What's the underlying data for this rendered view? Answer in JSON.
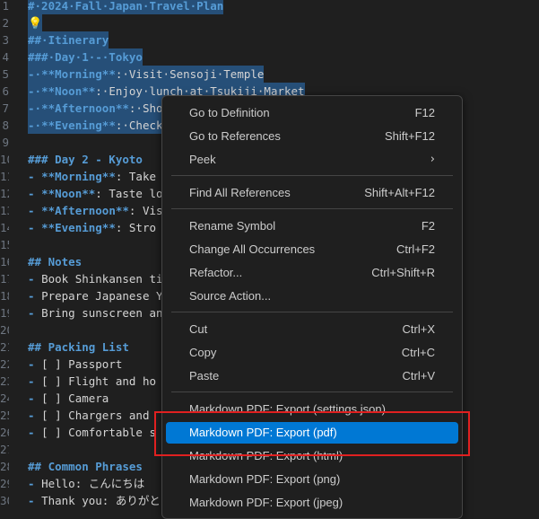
{
  "editor": {
    "lines": [
      {
        "num": "1",
        "segs": [
          {
            "t": "#·2024·Fall·Japan·Travel·Plan",
            "c": "hd"
          }
        ]
      },
      {
        "num": "2",
        "segs": [
          {
            "t": "💡",
            "c": "bulb"
          }
        ]
      },
      {
        "num": "3",
        "segs": [
          {
            "t": "##·Itinerary",
            "c": "hd"
          }
        ]
      },
      {
        "num": "4",
        "segs": [
          {
            "t": "###·Day·1·-·Tokyo",
            "c": "hd"
          }
        ]
      },
      {
        "num": "5",
        "segs": [
          {
            "t": "-·",
            "c": "hd"
          },
          {
            "t": "**Morning**",
            "c": "hd"
          },
          {
            "t": ":·Visit·Sensoji·Temple",
            "c": "tx"
          }
        ]
      },
      {
        "num": "6",
        "segs": [
          {
            "t": "-·",
            "c": "hd"
          },
          {
            "t": "**Noon**",
            "c": "hd"
          },
          {
            "t": ":·Enjoy·lunch·at·Tsukiji·Market",
            "c": "tx"
          }
        ]
      },
      {
        "num": "7",
        "segs": [
          {
            "t": "-·",
            "c": "hd"
          },
          {
            "t": "**Afternoon**",
            "c": "hd"
          },
          {
            "t": ":·Sho",
            "c": "tx"
          }
        ]
      },
      {
        "num": "8",
        "segs": [
          {
            "t": "-·",
            "c": "hd"
          },
          {
            "t": "**Evening**",
            "c": "hd"
          },
          {
            "t": ":·Check",
            "c": "tx"
          }
        ]
      },
      {
        "num": "9",
        "segs": []
      },
      {
        "num": "10",
        "segs": [
          {
            "t": "### Day 2 - Kyoto",
            "c": "hd"
          }
        ]
      },
      {
        "num": "11",
        "segs": [
          {
            "t": "- ",
            "c": "hd"
          },
          {
            "t": "**Morning**",
            "c": "hd"
          },
          {
            "t": ": Take",
            "c": "tx"
          }
        ]
      },
      {
        "num": "12",
        "segs": [
          {
            "t": "- ",
            "c": "hd"
          },
          {
            "t": "**Noon**",
            "c": "hd"
          },
          {
            "t": ": Taste lo",
            "c": "tx"
          }
        ]
      },
      {
        "num": "13",
        "segs": [
          {
            "t": "- ",
            "c": "hd"
          },
          {
            "t": "**Afternoon**",
            "c": "hd"
          },
          {
            "t": ": Vis",
            "c": "tx"
          }
        ]
      },
      {
        "num": "14",
        "segs": [
          {
            "t": "- ",
            "c": "hd"
          },
          {
            "t": "**Evening**",
            "c": "hd"
          },
          {
            "t": ": Stro",
            "c": "tx"
          }
        ]
      },
      {
        "num": "15",
        "segs": []
      },
      {
        "num": "16",
        "segs": [
          {
            "t": "## Notes",
            "c": "hd"
          }
        ]
      },
      {
        "num": "17",
        "segs": [
          {
            "t": "- ",
            "c": "hd"
          },
          {
            "t": "Book Shinkansen ti",
            "c": "tx"
          }
        ]
      },
      {
        "num": "18",
        "segs": [
          {
            "t": "- ",
            "c": "hd"
          },
          {
            "t": "Prepare Japanese Y",
            "c": "tx"
          }
        ]
      },
      {
        "num": "19",
        "segs": [
          {
            "t": "- ",
            "c": "hd"
          },
          {
            "t": "Bring sunscreen an",
            "c": "tx"
          }
        ]
      },
      {
        "num": "20",
        "segs": []
      },
      {
        "num": "21",
        "segs": [
          {
            "t": "## Packing List",
            "c": "hd"
          }
        ]
      },
      {
        "num": "22",
        "segs": [
          {
            "t": "- ",
            "c": "hd"
          },
          {
            "t": "[ ] Passport",
            "c": "tx"
          }
        ]
      },
      {
        "num": "23",
        "segs": [
          {
            "t": "- ",
            "c": "hd"
          },
          {
            "t": "[ ] Flight and ho",
            "c": "tx"
          }
        ]
      },
      {
        "num": "24",
        "segs": [
          {
            "t": "- ",
            "c": "hd"
          },
          {
            "t": "[ ] Camera",
            "c": "tx"
          }
        ]
      },
      {
        "num": "25",
        "segs": [
          {
            "t": "- ",
            "c": "hd"
          },
          {
            "t": "[ ] Chargers and",
            "c": "tx"
          }
        ]
      },
      {
        "num": "26",
        "segs": [
          {
            "t": "- ",
            "c": "hd"
          },
          {
            "t": "[ ] Comfortable s",
            "c": "tx"
          }
        ]
      },
      {
        "num": "27",
        "segs": []
      },
      {
        "num": "28",
        "segs": [
          {
            "t": "## Common Phrases",
            "c": "hd"
          }
        ]
      },
      {
        "num": "29",
        "segs": [
          {
            "t": "- ",
            "c": "hd"
          },
          {
            "t": "Hello: こんにちは",
            "c": "tx"
          }
        ]
      },
      {
        "num": "30",
        "segs": [
          {
            "t": "- ",
            "c": "hd"
          },
          {
            "t": "Thank you: ありがと",
            "c": "tx"
          }
        ]
      }
    ]
  },
  "menu": {
    "go_to_definition": {
      "label": "Go to Definition",
      "shortcut": "F12"
    },
    "go_to_references": {
      "label": "Go to References",
      "shortcut": "Shift+F12"
    },
    "peek": {
      "label": "Peek",
      "chevron": "›"
    },
    "find_all_references": {
      "label": "Find All References",
      "shortcut": "Shift+Alt+F12"
    },
    "rename_symbol": {
      "label": "Rename Symbol",
      "shortcut": "F2"
    },
    "change_all_occurrences": {
      "label": "Change All Occurrences",
      "shortcut": "Ctrl+F2"
    },
    "refactor": {
      "label": "Refactor...",
      "shortcut": "Ctrl+Shift+R"
    },
    "source_action": {
      "label": "Source Action..."
    },
    "cut": {
      "label": "Cut",
      "shortcut": "Ctrl+X"
    },
    "copy": {
      "label": "Copy",
      "shortcut": "Ctrl+C"
    },
    "paste": {
      "label": "Paste",
      "shortcut": "Ctrl+V"
    },
    "export_settings": {
      "label": "Markdown PDF: Export (settings.json)"
    },
    "export_pdf": {
      "label": "Markdown PDF: Export (pdf)"
    },
    "export_html": {
      "label": "Markdown PDF: Export (html)"
    },
    "export_png": {
      "label": "Markdown PDF: Export (png)"
    },
    "export_jpeg": {
      "label": "Markdown PDF: Export (jpeg)"
    }
  },
  "colors": {
    "selection": "#264f78",
    "heading": "#569cd6",
    "text": "#d4d4d4",
    "menu_bg": "#1f1f1f",
    "menu_active": "#0078d4",
    "highlight_border": "#e02020"
  }
}
